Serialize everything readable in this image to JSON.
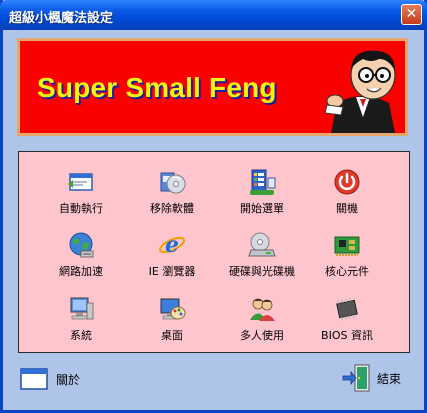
{
  "window": {
    "title": "超級小楓魔法設定",
    "close_glyph": "✕"
  },
  "banner": {
    "text": "Super Small Feng",
    "background": "#fc0000",
    "text_color": "#f4f410"
  },
  "grid": {
    "background": "#ffc5cd",
    "items": [
      {
        "label": "自動執行",
        "icon": "autorun-window-icon"
      },
      {
        "label": "移除軟體",
        "icon": "software-cd-box-icon"
      },
      {
        "label": "開始選單",
        "icon": "start-menu-icon"
      },
      {
        "label": "關機",
        "icon": "power-icon"
      },
      {
        "label": "網路加速",
        "icon": "network-globe-icon"
      },
      {
        "label": "IE 瀏覽器",
        "icon": "internet-explorer-icon"
      },
      {
        "label": "硬碟與光碟機",
        "icon": "disk-drive-icon"
      },
      {
        "label": "核心元件",
        "icon": "circuit-board-icon"
      },
      {
        "label": "系統",
        "icon": "system-computer-icon"
      },
      {
        "label": "桌面",
        "icon": "desktop-palette-icon"
      },
      {
        "label": "多人使用",
        "icon": "multi-user-icon"
      },
      {
        "label": "BIOS 資訊",
        "icon": "bios-chip-icon"
      }
    ]
  },
  "footer": {
    "about_label": "關於",
    "exit_label": "結束"
  }
}
